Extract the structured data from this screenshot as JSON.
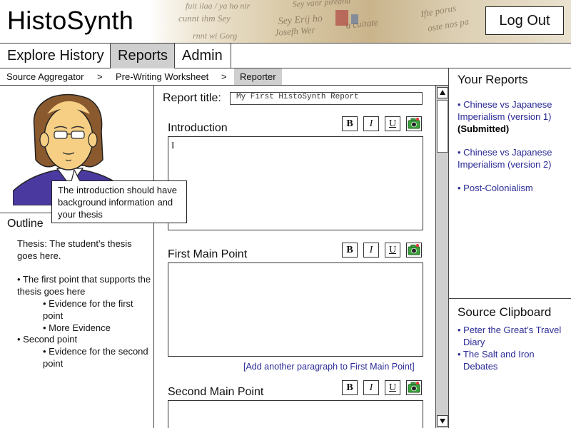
{
  "app": {
    "title": "HistoSynth",
    "logout_label": "Log Out"
  },
  "nav": {
    "tabs": [
      {
        "label": "Explore History",
        "active": false
      },
      {
        "label": "Reports",
        "active": true
      },
      {
        "label": "Admin",
        "active": false
      }
    ]
  },
  "breadcrumb": {
    "items": [
      "Source Aggregator",
      "Pre-Writing Worksheet",
      "Reporter"
    ],
    "separator": ">"
  },
  "mascot": {
    "speech": "The introduction should have background information and your thesis"
  },
  "outline": {
    "title": "Outline",
    "thesis": "Thesis: The student’s thesis goes here.",
    "point1": "• The first point that supports the thesis goes here",
    "evidence1": "• Evidence for the first point",
    "evidence2": "• More Evidence",
    "point2": "• Second point",
    "evidence3": "• Evidence for the second point"
  },
  "report": {
    "title_label": "Report title:",
    "title_value": "My First HistoSynth Report",
    "sections": [
      {
        "title": "Introduction"
      },
      {
        "title": "First Main Point",
        "add_link": "[Add another paragraph to First Main Point]"
      },
      {
        "title": "Second Main Point"
      }
    ],
    "toolbar": {
      "bold": "B",
      "italic": "I",
      "underline": "U"
    },
    "cursor": "I"
  },
  "your_reports": {
    "title": "Your Reports",
    "items": [
      {
        "label": "• Chinese vs Japanese Imperialism (version 1)",
        "status": "(Submitted)"
      },
      {
        "label": "• Chinese vs Japanese Imperialism (version 2)"
      },
      {
        "label": "• Post-Colonialism"
      }
    ]
  },
  "clipboard": {
    "title": "Source Clipboard",
    "items": [
      "• Peter the Great’s Travel Diary",
      "• The Salt and Iron Debates"
    ]
  },
  "colors": {
    "link": "#2a2a96",
    "active_tab": "#cfcfcf",
    "border": "#444444"
  },
  "icons": {
    "insert_image": "camera-icon",
    "scroll_up": "arrow-up-icon",
    "scroll_down": "arrow-down-icon"
  }
}
